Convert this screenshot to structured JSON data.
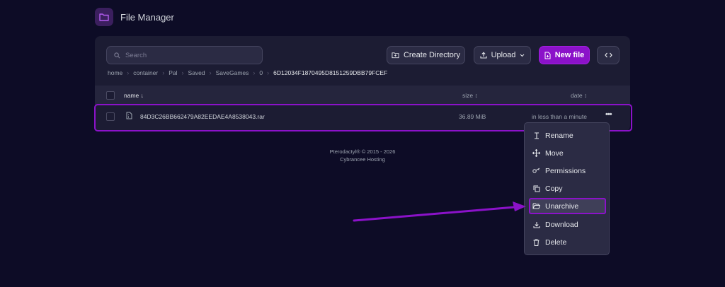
{
  "header": {
    "title": "File Manager"
  },
  "toolbar": {
    "search_placeholder": "Search",
    "create_directory_label": "Create Directory",
    "upload_label": "Upload",
    "new_file_label": "New file"
  },
  "breadcrumb": [
    "home",
    "container",
    "Pal",
    "Saved",
    "SaveGames",
    "0",
    "6D12034F1870495D8151259DBB79FCEF"
  ],
  "table": {
    "columns": {
      "name": "name ↓",
      "size": "size ↕",
      "date": "date ↕"
    },
    "rows": [
      {
        "name": "84D3C26BB662479A82EEDAE4A8538043.rar",
        "size": "36.89 MiB",
        "date": "in less than a minute"
      }
    ]
  },
  "footer": {
    "line1": "Pterodactyl® © 2015 - 2026",
    "line2": "Cybrancee Hosting"
  },
  "context_menu": {
    "items": [
      "Rename",
      "Move",
      "Permissions",
      "Copy",
      "Unarchive",
      "Download",
      "Delete"
    ],
    "active_item": "Unarchive"
  },
  "colors": {
    "accent": "#8b12c9",
    "background": "#0d0c26",
    "panel": "#1c1c33"
  }
}
